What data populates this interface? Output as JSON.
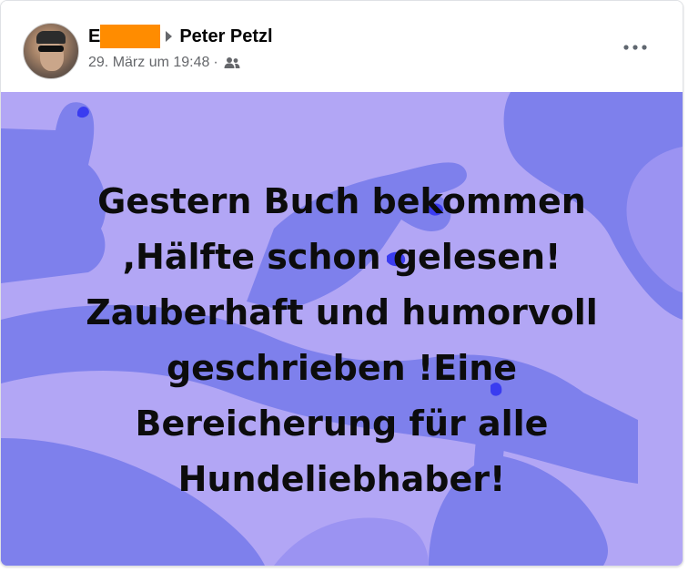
{
  "post": {
    "author_initial": "E",
    "author_redacted": true,
    "target_name": "Peter Petzl",
    "timestamp": "29. März um 19:48",
    "separator": "·",
    "audience_icon": "friends-icon",
    "more_icon": "more-options-icon",
    "text": "Gestern Buch bekommen\n,Hälfte schon gelesen!\nZauberhaft und humorvoll\ngeschrieben !Eine\nBereicherung für alle\nHundeliebhaber!"
  },
  "colors": {
    "redaction": "#ff8c00",
    "background_light": "#b2a6f5",
    "background_hands": "#7e80ec",
    "accent_nail": "#3a3cf0",
    "text": "#0c0c0c"
  }
}
